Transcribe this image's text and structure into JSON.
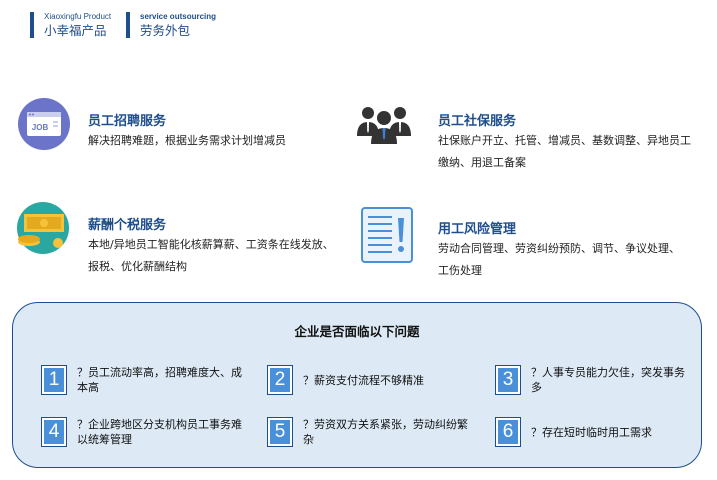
{
  "header": {
    "left_en": "Xiaoxingfu Product",
    "left_cn": "小幸福产品",
    "right_en": "service outsourcing",
    "right_cn": "劳务外包"
  },
  "services": [
    {
      "title": "员工招聘服务",
      "desc": "解决招聘难题，根据业务需求计划增减员",
      "icon": "job-icon",
      "icon_text": "JOB"
    },
    {
      "title": "员工社保服务",
      "desc": "社保账户开立、托管、增减员、基数调整、异地员工缴纳、用退工备案",
      "icon": "people-icon"
    },
    {
      "title": "薪酬个税服务",
      "desc": "本地/异地员工智能化核薪算薪、工资条在线发放、报税、优化薪酬结构",
      "icon": "money-icon"
    },
    {
      "title": "用工风险管理",
      "desc": "劳动合同管理、劳资纠纷预防、调节、争议处理、工伤处理",
      "icon": "document-icon"
    }
  ],
  "panel": {
    "title": "企业是否面临以下问题",
    "issues": [
      {
        "num": "1",
        "text": "？员工流动率高，招聘难度大、成本高"
      },
      {
        "num": "2",
        "text": "？薪资支付流程不够精准"
      },
      {
        "num": "3",
        "text": "？人事专员能力欠佳，突发事务多"
      },
      {
        "num": "4",
        "text": "？企业跨地区分支机构员工事务难以统筹管理"
      },
      {
        "num": "5",
        "text": "？劳资双方关系紧张，劳动纠纷繁杂"
      },
      {
        "num": "6",
        "text": "？存在短时临时用工需求"
      }
    ]
  },
  "colors": {
    "primary": "#1f4e8c",
    "accent": "#4a90d9",
    "panel_bg": "#dde9f5"
  }
}
